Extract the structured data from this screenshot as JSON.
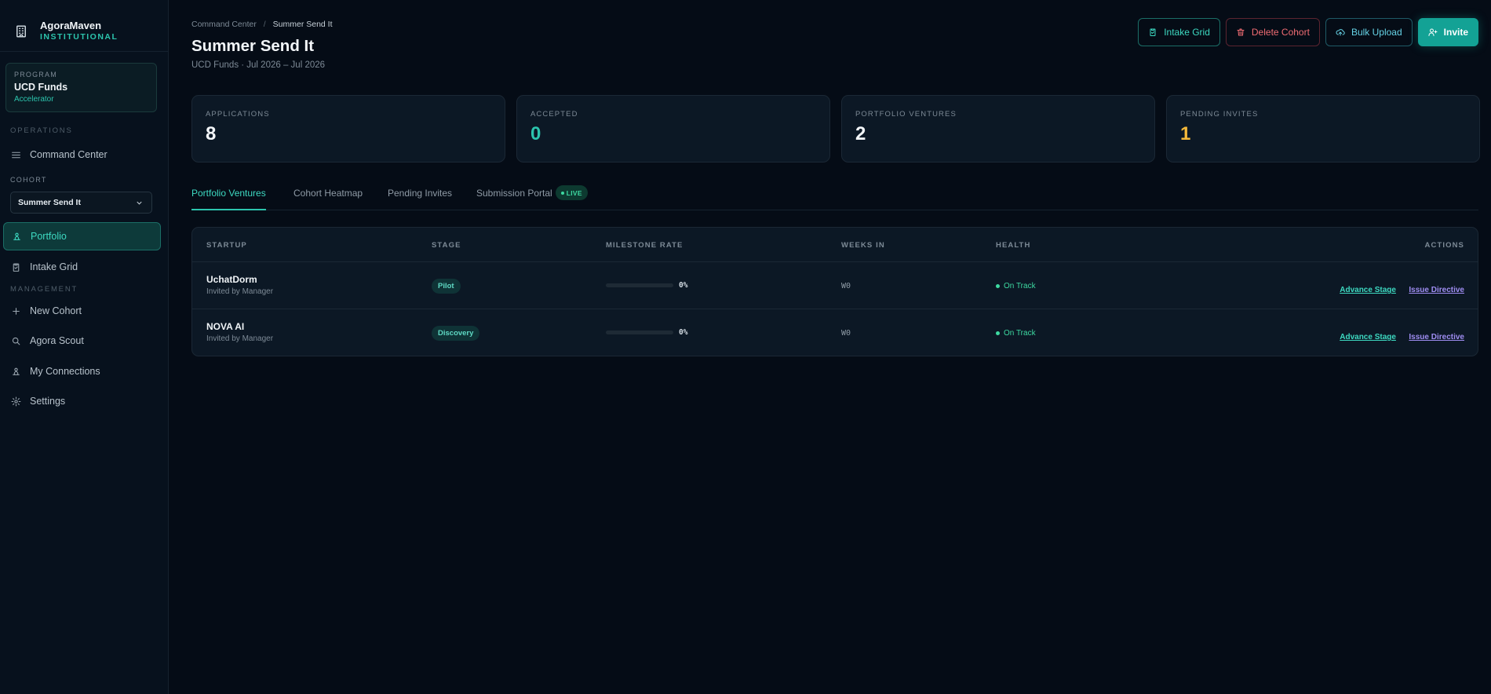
{
  "brand": {
    "name": "AgoraMaven",
    "subtitle": "INSTITUTIONAL"
  },
  "program": {
    "label": "PROGRAM",
    "name": "UCD Funds",
    "type": "Accelerator"
  },
  "sidebar": {
    "operations_label": "OPERATIONS",
    "command_center": "Command Center",
    "cohort_label": "COHORT",
    "cohort_selected": "Summer Send It",
    "portfolio": "Portfolio",
    "intake_grid": "Intake Grid",
    "management_label": "MANAGEMENT",
    "new_cohort": "New Cohort",
    "agora_scout": "Agora Scout",
    "my_connections": "My Connections",
    "settings": "Settings"
  },
  "breadcrumb": {
    "root": "Command Center",
    "separator": "/",
    "current": "Summer Send It"
  },
  "page": {
    "title": "Summer Send It",
    "subtitle": "UCD Funds · Jul 2026 – Jul 2026"
  },
  "actions": {
    "intake_grid": "Intake Grid",
    "delete_cohort": "Delete Cohort",
    "bulk_upload": "Bulk Upload",
    "invite": "Invite"
  },
  "stats": [
    {
      "label": "APPLICATIONS",
      "value": "8",
      "color": "#f3f6f9"
    },
    {
      "label": "ACCEPTED",
      "value": "0",
      "color": "#2cc4ad"
    },
    {
      "label": "PORTFOLIO VENTURES",
      "value": "2",
      "color": "#f3f6f9"
    },
    {
      "label": "PENDING INVITES",
      "value": "1",
      "color": "#f5b93a"
    }
  ],
  "tabs": {
    "portfolio_ventures": "Portfolio Ventures",
    "cohort_heatmap": "Cohort Heatmap",
    "pending_invites": "Pending Invites",
    "submission_portal": "Submission Portal",
    "live_badge": "LIVE"
  },
  "table": {
    "headers": {
      "startup": "STARTUP",
      "stage": "STAGE",
      "milestone_rate": "MILESTONE RATE",
      "weeks_in": "WEEKS IN",
      "health": "HEALTH",
      "actions": "ACTIONS"
    },
    "rows": [
      {
        "name": "UchatDorm",
        "sub": "Invited by Manager",
        "stage": "Pilot",
        "milestone_pct": "0%",
        "milestone_fraction": 0,
        "weeks": "W0",
        "health": "On Track",
        "advance": "Advance Stage",
        "issue": "Issue Directive"
      },
      {
        "name": "NOVA AI",
        "sub": "Invited by Manager",
        "stage": "Discovery",
        "milestone_pct": "0%",
        "milestone_fraction": 0,
        "weeks": "W0",
        "health": "On Track",
        "advance": "Advance Stage",
        "issue": "Issue Directive"
      }
    ]
  }
}
